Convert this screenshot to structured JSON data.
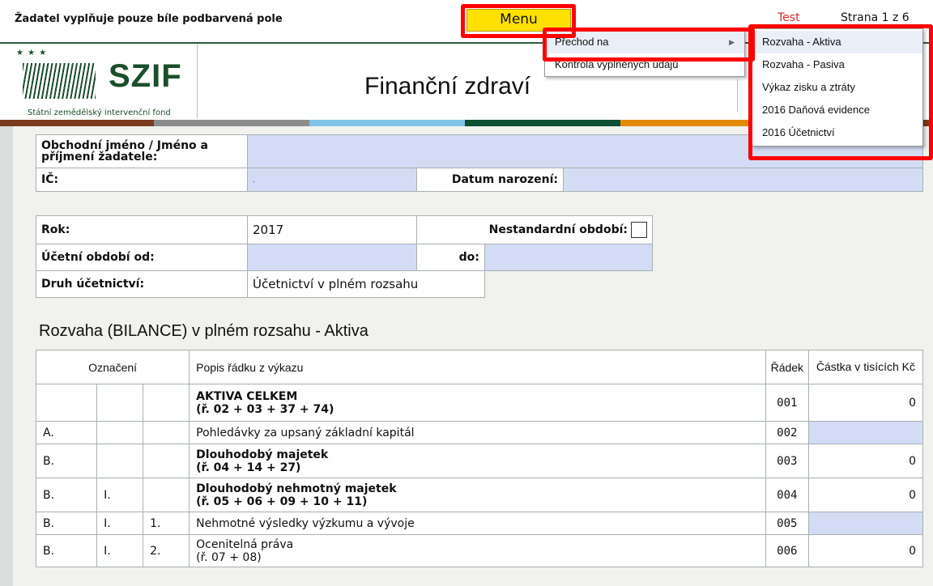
{
  "topbar": {
    "note": "Žadatel vyplňuje pouze bíle podbarvená pole",
    "menu": "Menu",
    "test": "Test",
    "page": "Strana 1 z 6"
  },
  "logo": {
    "stars": "★ ★ ★",
    "name": "SZIF",
    "subtitle": "Státní zemědělský intervenční fond"
  },
  "title": "Finanční zdraví",
  "colors": {
    "brown": "#7a3b1e",
    "grey": "#8c8c8c",
    "blue": "#7ec3e6",
    "green": "#0d4f32",
    "orange": "#e38a00",
    "highlight": "#d4dcf5",
    "menu": "#ffe100"
  },
  "form": {
    "name_label": "Obchodní jméno / Jméno a příjmení žadatele:",
    "ic_label": "IČ:",
    "ic_value": ".",
    "dob_label": "Datum narození:",
    "year_label": "Rok:",
    "year_value": "2017",
    "nonstandard_label": "Nestandardní období:",
    "period_from_label": "Účetní období od:",
    "period_to_label": "do:",
    "type_label": "Druh účetnictví:",
    "type_value": "Účetnictví v plném rozsahu"
  },
  "section_title": "Rozvaha (BILANCE) v plném rozsahu - Aktiva",
  "table": {
    "headers": {
      "designation": "Označení",
      "description": "Popis řádku z výkazu",
      "row": "Řádek",
      "amount": "Částka v tisících Kč"
    },
    "rows": [
      {
        "c1": "",
        "c2": "",
        "c3": "",
        "desc1": "AKTIVA CELKEM",
        "desc2": "(ř. 02 + 03 + 37 + 74)",
        "row": "001",
        "amount": "0"
      },
      {
        "c1": "A.",
        "c2": "",
        "c3": "",
        "desc1": "Pohledávky za upsaný základní kapitál",
        "desc2": "",
        "row": "002",
        "amount": ""
      },
      {
        "c1": "B.",
        "c2": "",
        "c3": "",
        "desc1": "Dlouhodobý majetek",
        "desc2": "(ř. 04 + 14 + 27)",
        "row": "003",
        "amount": "0"
      },
      {
        "c1": "B.",
        "c2": "I.",
        "c3": "",
        "desc1": "Dlouhodobý nehmotný majetek",
        "desc2": "(ř. 05 + 06 + 09 + 10 + 11)",
        "row": "004",
        "amount": "0"
      },
      {
        "c1": "B.",
        "c2": "I.",
        "c3": "1.",
        "desc1": "Nehmotné výsledky výzkumu a vývoje",
        "desc2": "",
        "row": "005",
        "amount": ""
      },
      {
        "c1": "B.",
        "c2": "I.",
        "c3": "2.",
        "desc1": "Ocenitelná práva",
        "desc2": "(ř. 07 + 08)",
        "row": "006",
        "amount": "0"
      }
    ]
  },
  "menu": {
    "items": [
      "Přechod na",
      "Kontrola vyplněných údajů"
    ],
    "submenu": [
      "Rozvaha - Aktiva",
      "Rozvaha - Pasiva",
      "Výkaz zisku a ztráty",
      "2016 Daňová evidence",
      "2016 Účetnictví"
    ]
  }
}
